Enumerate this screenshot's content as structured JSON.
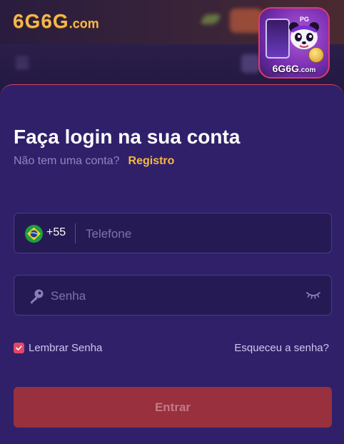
{
  "header": {
    "logo_main": "6G6G",
    "logo_suffix": ".com",
    "app_icon_label_main": "6G6G",
    "app_icon_label_suffix": ".com",
    "app_icon_badge": "PG"
  },
  "login": {
    "title": "Faça login na sua conta",
    "no_account_text": "Não tem uma conta?",
    "register_link": "Registro",
    "country_code": "+55",
    "country_flag": "brazil-flag-icon",
    "phone_placeholder": "Telefone",
    "phone_value": "",
    "password_placeholder": "Senha",
    "password_value": "",
    "remember_label": "Lembrar Senha",
    "remember_checked": true,
    "forgot_link": "Esqueceu a senha?",
    "submit_label": "Entrar"
  },
  "colors": {
    "modal_bg": "#30206a",
    "accent_gold": "#f5b83d",
    "accent_pink": "#e24667",
    "submit_bg": "#98303e"
  }
}
